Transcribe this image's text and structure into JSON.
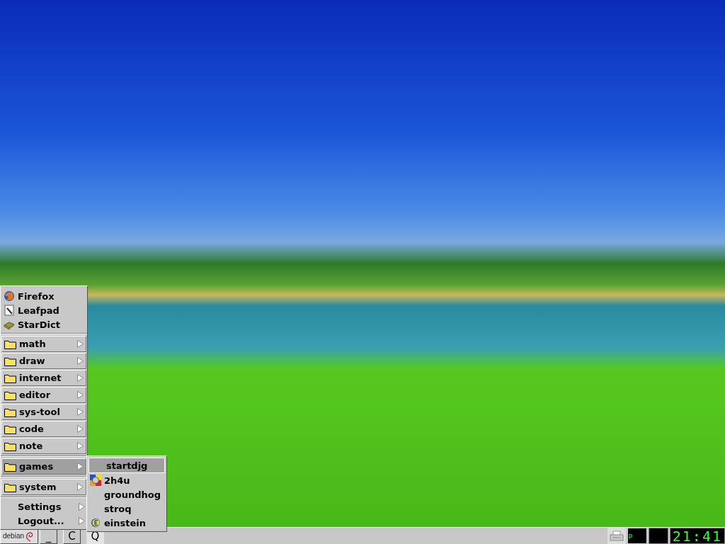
{
  "menu": {
    "items": [
      {
        "kind": "browser",
        "label": "Firefox",
        "selected": false
      },
      {
        "kind": "editor",
        "label": "Leafpad",
        "selected": false
      },
      {
        "kind": "book",
        "label": "StarDict",
        "selected": false
      },
      {
        "kind": "separator"
      },
      {
        "kind": "folder",
        "label": "math",
        "selected": false
      },
      {
        "kind": "folder",
        "label": "draw",
        "selected": false
      },
      {
        "kind": "folder",
        "label": "internet",
        "selected": false
      },
      {
        "kind": "folder",
        "label": "editor",
        "selected": false
      },
      {
        "kind": "folder",
        "label": "sys-tool",
        "selected": false
      },
      {
        "kind": "folder",
        "label": "code",
        "selected": false
      },
      {
        "kind": "folder",
        "label": "note",
        "selected": false
      },
      {
        "kind": "separator"
      },
      {
        "kind": "folder",
        "label": "games",
        "selected": true
      },
      {
        "kind": "separator"
      },
      {
        "kind": "folder",
        "label": "system",
        "selected": false
      },
      {
        "kind": "separator"
      },
      {
        "kind": "plain",
        "label": "Settings",
        "selected": false
      },
      {
        "kind": "plain",
        "label": "Logout...",
        "selected": false
      }
    ]
  },
  "submenu": {
    "items": [
      {
        "kind": "plain",
        "label": "startdjg",
        "selected": true
      },
      {
        "kind": "ball",
        "label": "2h4u",
        "selected": false
      },
      {
        "kind": "plain",
        "label": "groundhog",
        "selected": false
      },
      {
        "kind": "plain",
        "label": "stroq",
        "selected": false
      },
      {
        "kind": "badge",
        "label": "einstein",
        "selected": false
      }
    ]
  },
  "taskbar": {
    "logo": "debian",
    "buttons": [
      {
        "label": "_",
        "selected": false
      },
      {
        "label": "C",
        "selected": false
      },
      {
        "label": "Q",
        "selected": true
      }
    ],
    "pager": [
      {
        "label": "P",
        "selected": true
      },
      {
        "selected": false
      }
    ],
    "clock": "21:41"
  }
}
